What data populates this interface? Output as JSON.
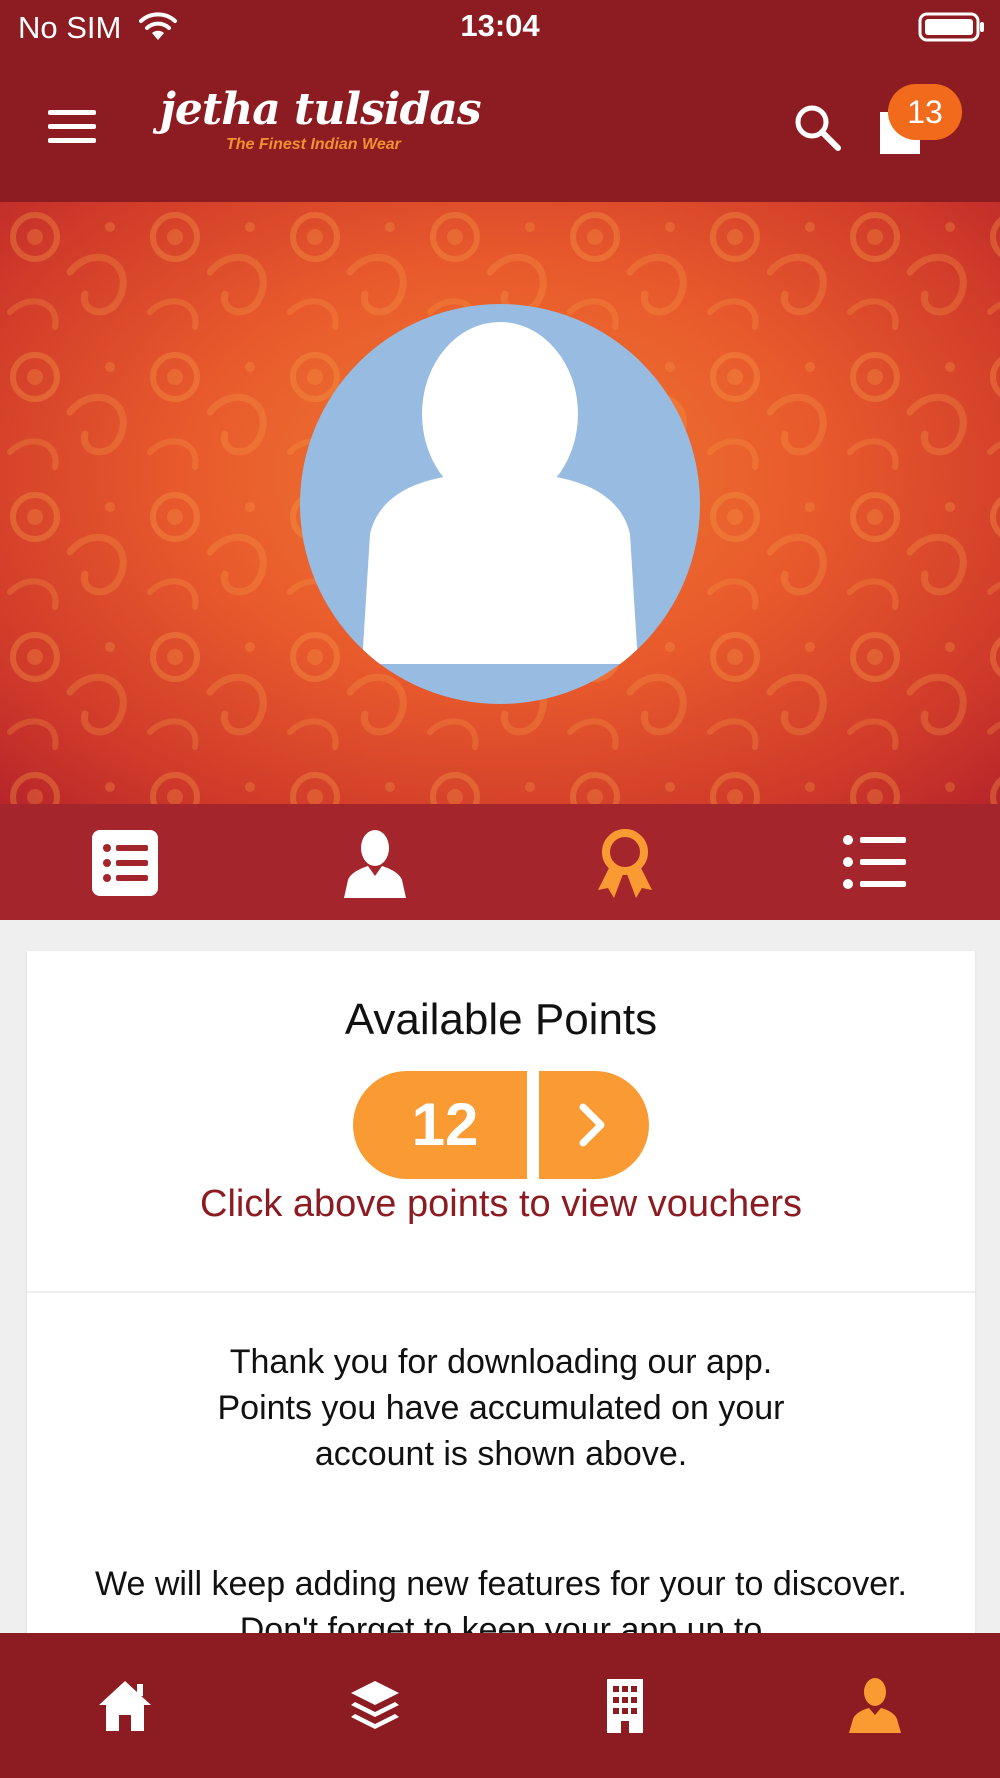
{
  "status_bar": {
    "carrier": "No SIM",
    "time": "13:04",
    "icons": [
      "wifi-icon",
      "battery-icon"
    ]
  },
  "header": {
    "brand_name": "jetha tulsidas",
    "brand_tagline": "The Finest Indian Wear",
    "cart_count": "13",
    "icons": [
      "menu-icon",
      "search-icon",
      "shopping-bag-icon"
    ]
  },
  "profile_tabs": {
    "items": [
      {
        "icon": "order-list-icon",
        "active": false
      },
      {
        "icon": "user-icon",
        "active": false
      },
      {
        "icon": "award-ribbon-icon",
        "active": true
      },
      {
        "icon": "bulleted-list-icon",
        "active": false
      }
    ]
  },
  "points_card": {
    "title": "Available Points",
    "points": "12",
    "hint": "Click above points to view vouchers",
    "thanks_message": "Thank you for downloading our app.\nPoints you have accumulated on your\naccount is shown above.",
    "features_message": "We will keep adding new features for your to discover. Don't forget to keep your app up to"
  },
  "bottom_nav": {
    "items": [
      {
        "icon": "home-icon",
        "active": false
      },
      {
        "icon": "layers-icon",
        "active": false
      },
      {
        "icon": "building-icon",
        "active": false
      },
      {
        "icon": "user-icon",
        "active": true
      }
    ]
  },
  "colors": {
    "header_bg": "#8d1c22",
    "tab_bar_bg": "#a5252c",
    "accent_orange": "#f99a32",
    "badge_orange": "#f26a1b",
    "hint_text": "#8d1c22",
    "avatar_bg": "#97bbe1"
  }
}
